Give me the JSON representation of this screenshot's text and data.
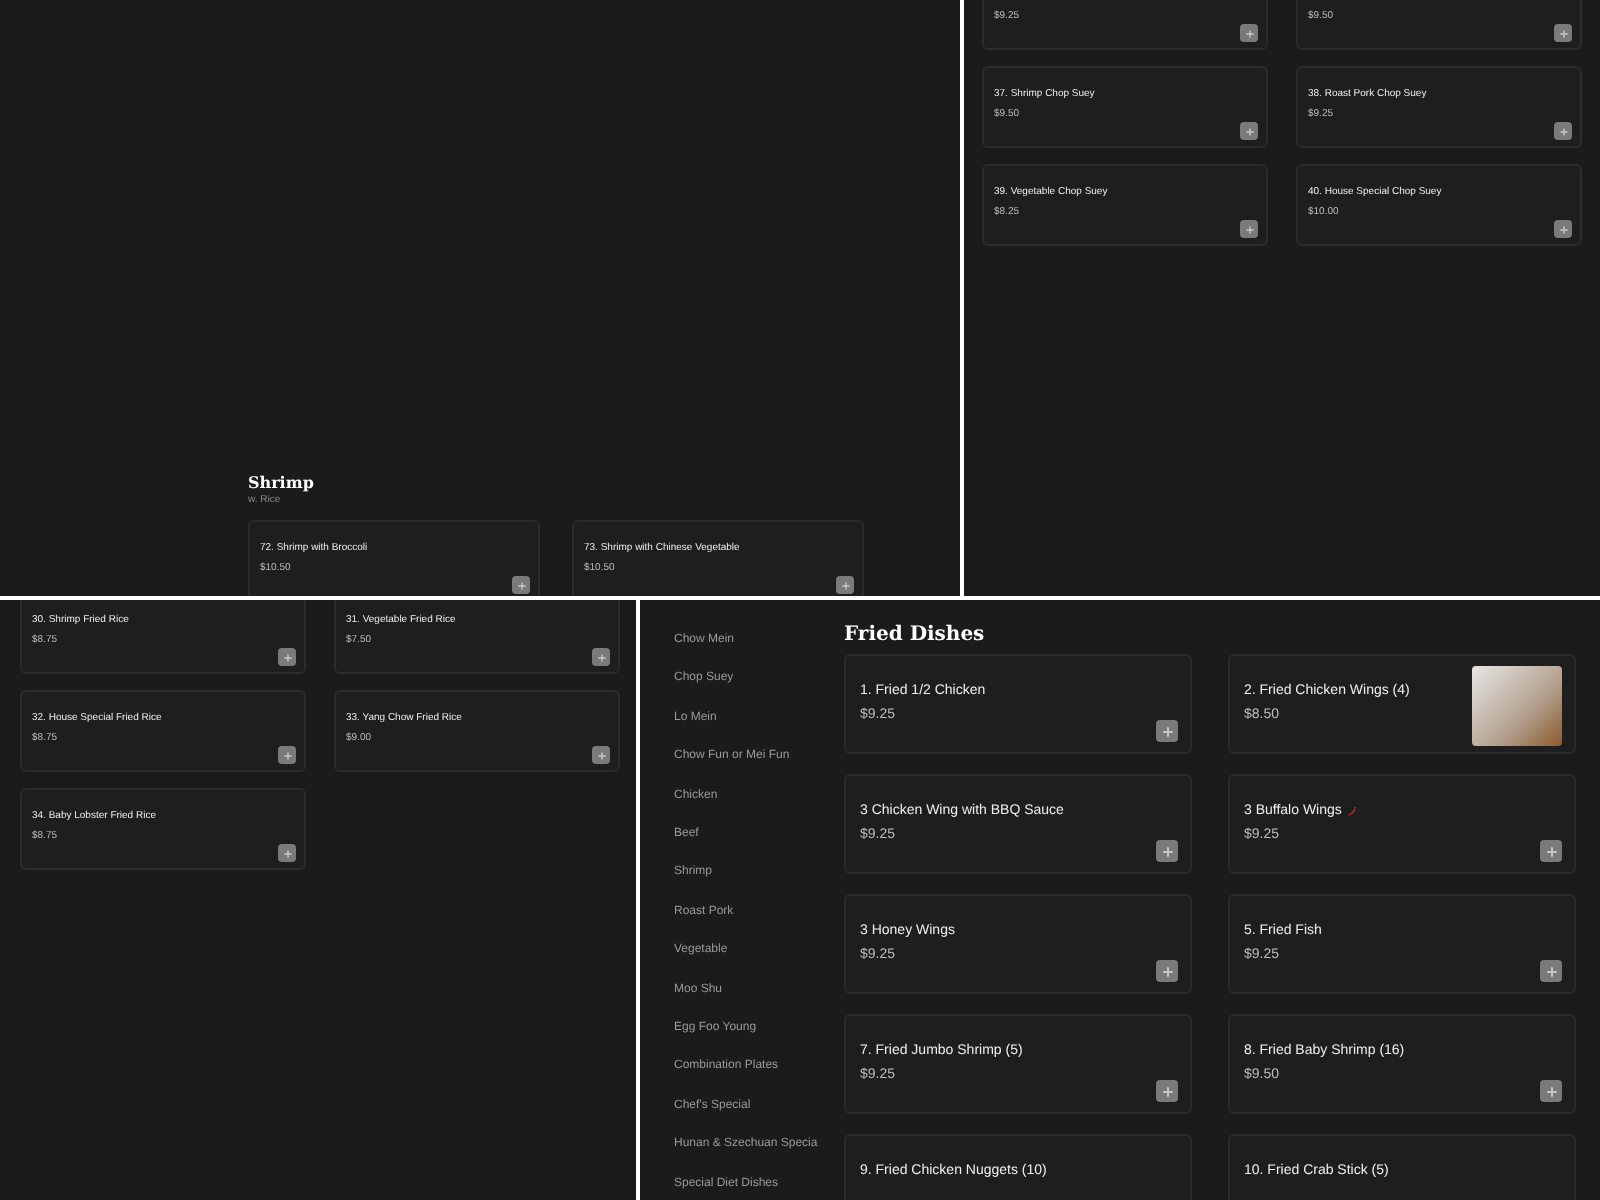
{
  "panels": [
    {
      "kind": "section",
      "heading": "Shrimp",
      "subheading": "w. Rice",
      "items": [
        {
          "name": "72. Shrimp with Broccoli",
          "price": "$10.50"
        },
        {
          "name": "73. Shrimp with Chinese Vegetable",
          "price": "$10.50"
        }
      ]
    },
    {
      "kind": "grid",
      "items": [
        {
          "price": "$9.25"
        },
        {
          "price": "$9.50"
        },
        {
          "name": "37. Shrimp Chop Suey",
          "price": "$9.50"
        },
        {
          "name": "38. Roast Pork Chop Suey",
          "price": "$9.25"
        },
        {
          "name": "39. Vegetable Chop Suey",
          "price": "$8.25"
        },
        {
          "name": "40. House Special Chop Suey",
          "price": "$10.00"
        }
      ]
    },
    {
      "kind": "grid",
      "items": [
        {
          "name": "30. Shrimp Fried Rice",
          "price": "$8.75"
        },
        {
          "name": "31. Vegetable Fried Rice",
          "price": "$7.50"
        },
        {
          "name": "32. House Special Fried Rice",
          "price": "$8.75"
        },
        {
          "name": "33. Yang Chow Fried Rice",
          "price": "$9.00"
        },
        {
          "name": "34. Baby Lobster Fried Rice",
          "price": "$8.75"
        }
      ]
    },
    {
      "kind": "menu",
      "sidebar": [
        "Chow Mein",
        "Chop Suey",
        "Lo Mein",
        "Chow Fun or Mei Fun",
        "Chicken",
        "Beef",
        "Shrimp",
        "Roast Pork",
        "Vegetable",
        "Moo Shu",
        "Egg Foo Young",
        "Combination Plates",
        "Chef's Special",
        "Hunan & Szechuan Specia",
        "Special Diet Dishes"
      ],
      "heading": "Fried Dishes",
      "items": [
        {
          "name": "1. Fried 1/2 Chicken",
          "price": "$9.25",
          "kind": "plain",
          "spicy": false
        },
        {
          "name": "2. Fried Chicken Wings (4)",
          "price": "$8.50",
          "kind": "photo",
          "spicy": false
        },
        {
          "name": "3 Chicken Wing with BBQ Sauce",
          "price": "$9.25",
          "kind": "plain",
          "spicy": false
        },
        {
          "name": "3 Buffalo Wings",
          "price": "$9.25",
          "kind": "plain",
          "spicy": true
        },
        {
          "name": "3 Honey Wings",
          "price": "$9.25",
          "kind": "plain",
          "spicy": false
        },
        {
          "name": "5. Fried Fish",
          "price": "$9.25",
          "kind": "plain",
          "spicy": false
        },
        {
          "name": "7. Fried Jumbo Shrimp (5)",
          "price": "$9.25",
          "kind": "plain",
          "spicy": false
        },
        {
          "name": "8. Fried Baby Shrimp (16)",
          "price": "$9.50",
          "kind": "plain",
          "spicy": false
        },
        {
          "name": "9. Fried Chicken Nuggets (10)",
          "kind": "plain",
          "spicy": false
        },
        {
          "name": "10. Fried Crab Stick (5)",
          "kind": "plain",
          "spicy": false
        }
      ]
    }
  ]
}
